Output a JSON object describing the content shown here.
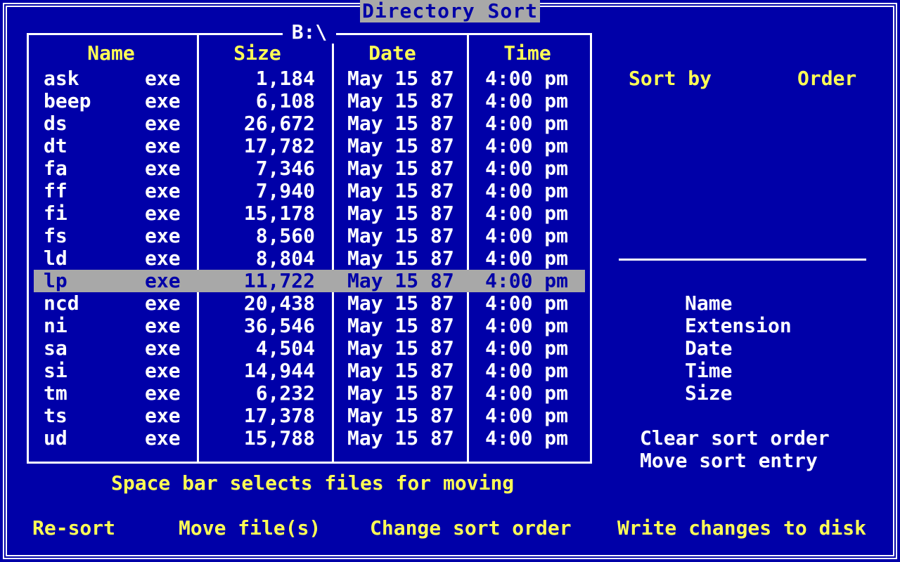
{
  "title": "Directory Sort",
  "path": "B:\\",
  "columns": {
    "name": "Name",
    "size": "Size",
    "date": "Date",
    "time": "Time"
  },
  "files": [
    {
      "name": "ask",
      "ext": "exe",
      "size": "1,184",
      "date": "May 15 87",
      "time": "4:00 pm"
    },
    {
      "name": "beep",
      "ext": "exe",
      "size": "6,108",
      "date": "May 15 87",
      "time": "4:00 pm"
    },
    {
      "name": "ds",
      "ext": "exe",
      "size": "26,672",
      "date": "May 15 87",
      "time": "4:00 pm"
    },
    {
      "name": "dt",
      "ext": "exe",
      "size": "17,782",
      "date": "May 15 87",
      "time": "4:00 pm"
    },
    {
      "name": "fa",
      "ext": "exe",
      "size": "7,346",
      "date": "May 15 87",
      "time": "4:00 pm"
    },
    {
      "name": "ff",
      "ext": "exe",
      "size": "7,940",
      "date": "May 15 87",
      "time": "4:00 pm"
    },
    {
      "name": "fi",
      "ext": "exe",
      "size": "15,178",
      "date": "May 15 87",
      "time": "4:00 pm"
    },
    {
      "name": "fs",
      "ext": "exe",
      "size": "8,560",
      "date": "May 15 87",
      "time": "4:00 pm"
    },
    {
      "name": "ld",
      "ext": "exe",
      "size": "8,804",
      "date": "May 15 87",
      "time": "4:00 pm"
    },
    {
      "name": "lp",
      "ext": "exe",
      "size": "11,722",
      "date": "May 15 87",
      "time": "4:00 pm"
    },
    {
      "name": "ncd",
      "ext": "exe",
      "size": "20,438",
      "date": "May 15 87",
      "time": "4:00 pm"
    },
    {
      "name": "ni",
      "ext": "exe",
      "size": "36,546",
      "date": "May 15 87",
      "time": "4:00 pm"
    },
    {
      "name": "sa",
      "ext": "exe",
      "size": "4,504",
      "date": "May 15 87",
      "time": "4:00 pm"
    },
    {
      "name": "si",
      "ext": "exe",
      "size": "14,944",
      "date": "May 15 87",
      "time": "4:00 pm"
    },
    {
      "name": "tm",
      "ext": "exe",
      "size": "6,232",
      "date": "May 15 87",
      "time": "4:00 pm"
    },
    {
      "name": "ts",
      "ext": "exe",
      "size": "17,378",
      "date": "May 15 87",
      "time": "4:00 pm"
    },
    {
      "name": "ud",
      "ext": "exe",
      "size": "15,788",
      "date": "May 15 87",
      "time": "4:00 pm"
    }
  ],
  "selected_file": "lp",
  "hint": "Space bar selects files for moving",
  "sort_panel": {
    "sort_by_label": "Sort by",
    "order_label": "Order",
    "options": [
      "Name",
      "Extension",
      "Date",
      "Time",
      "Size"
    ],
    "clear_label": "Clear sort order",
    "move_label": "Move sort entry"
  },
  "commands": {
    "resort": "Re-sort",
    "move_files": "Move file(s)",
    "change_order": "Change sort order",
    "write_changes": "Write changes to disk"
  },
  "colors": {
    "background": "#0000a8",
    "highlight": "#ffff55",
    "text": "#ffffff",
    "selection": "#a8a8a8"
  }
}
